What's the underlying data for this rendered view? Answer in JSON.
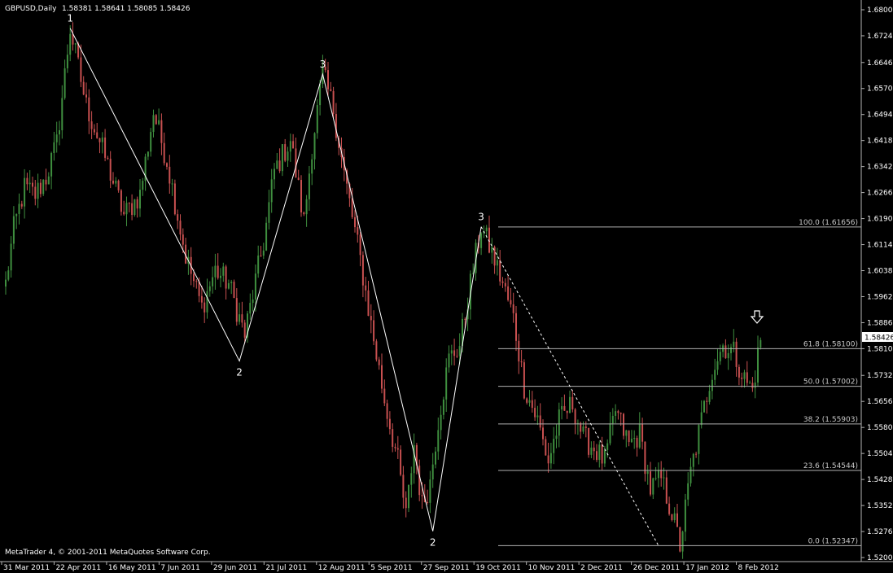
{
  "header": {
    "symbol": "GBPUSD,Daily",
    "ohlc": "1.58381 1.58641 1.58085 1.58426"
  },
  "footer": {
    "copyright": "MetaTrader 4, © 2001-2011 MetaQuotes Software Corp."
  },
  "colors": {
    "background": "#000000",
    "bull": "#3f8f3f",
    "bear": "#c85050",
    "lines": "#ffffff",
    "fib": "#b0b0b0",
    "frame": "#b4b4b4"
  },
  "chart_data": {
    "type": "candlestick",
    "y_ticks": [
      "1.68000",
      "1.67240",
      "1.66460",
      "1.65700",
      "1.64940",
      "1.64180",
      "1.63420",
      "1.62660",
      "1.61900",
      "1.61140",
      "1.60380",
      "1.59620",
      "1.58860",
      "1.58100",
      "1.57320",
      "1.56560",
      "1.55800",
      "1.55040",
      "1.54280",
      "1.53520",
      "1.52760",
      "1.52000"
    ],
    "ylim": [
      1.52,
      1.68
    ],
    "x_ticks": [
      "31 Mar 2011",
      "22 Apr 2011",
      "16 May 2011",
      "7 Jun 2011",
      "29 Jun 2011",
      "21 Jul 2011",
      "12 Aug 2011",
      "5 Sep 2011",
      "27 Sep 2011",
      "19 Oct 2011",
      "10 Nov 2011",
      "2 Dec 2011",
      "26 Dec 2011",
      "17 Jan 2012",
      "8 Feb 2012"
    ],
    "current_price": "1.58426",
    "wave_markers": [
      {
        "label": "1",
        "date": "22 Apr 2011",
        "price": 1.6746
      },
      {
        "label": "2",
        "date": "29 Jun 2011",
        "price": 1.5774
      },
      {
        "label": "3",
        "date": "12 Aug 2011",
        "price": 1.6612
      },
      {
        "label": "2",
        "date": "27 Sep 2011",
        "price": 1.5277
      },
      {
        "label": "3",
        "date": "19 Oct 2011",
        "price": 1.6166
      }
    ],
    "fibonacci": [
      {
        "label": "100.0 (1.61656)",
        "price": 1.61656
      },
      {
        "label": "61.8 (1.58100)",
        "price": 1.581
      },
      {
        "label": "50.0 (1.57002)",
        "price": 1.57002
      },
      {
        "label": "38.2 (1.55903)",
        "price": 1.55903
      },
      {
        "label": "23.6 (1.54544)",
        "price": 1.54544
      },
      {
        "label": "0.0 (1.52347)",
        "price": 1.52347
      }
    ],
    "fib_range": [
      "19 Oct 2011",
      "Jan 2012"
    ],
    "last_arrow": "down",
    "price_path": [
      [
        0,
        1.6
      ],
      [
        3,
        1.616
      ],
      [
        7,
        1.628
      ],
      [
        11,
        1.626
      ],
      [
        15,
        1.631
      ],
      [
        19,
        1.641
      ],
      [
        24,
        1.6746
      ],
      [
        30,
        1.652
      ],
      [
        37,
        1.637
      ],
      [
        44,
        1.62
      ],
      [
        50,
        1.626
      ],
      [
        55,
        1.65
      ],
      [
        60,
        1.636
      ],
      [
        67,
        1.608
      ],
      [
        73,
        1.593
      ],
      [
        78,
        1.604
      ],
      [
        83,
        1.6
      ],
      [
        89,
        1.585
      ],
      [
        92,
        1.597
      ],
      [
        96,
        1.612
      ],
      [
        100,
        1.633
      ],
      [
        106,
        1.642
      ],
      [
        111,
        1.618
      ],
      [
        114,
        1.64
      ],
      [
        118,
        1.6612
      ],
      [
        122,
        1.651
      ],
      [
        126,
        1.632
      ],
      [
        132,
        1.607
      ],
      [
        136,
        1.588
      ],
      [
        141,
        1.566
      ],
      [
        146,
        1.548
      ],
      [
        149,
        1.532
      ],
      [
        152,
        1.553
      ],
      [
        155,
        1.535
      ],
      [
        158,
        1.542
      ],
      [
        161,
        1.56
      ],
      [
        165,
        1.578
      ],
      [
        169,
        1.582
      ],
      [
        173,
        1.6
      ],
      [
        177,
        1.6166
      ],
      [
        181,
        1.609
      ],
      [
        185,
        1.6
      ],
      [
        189,
        1.59
      ],
      [
        193,
        1.57
      ],
      [
        198,
        1.56
      ],
      [
        202,
        1.548
      ],
      [
        206,
        1.56
      ],
      [
        211,
        1.565
      ],
      [
        215,
        1.555
      ],
      [
        219,
        1.552
      ],
      [
        223,
        1.548
      ],
      [
        227,
        1.563
      ],
      [
        232,
        1.553
      ],
      [
        236,
        1.556
      ],
      [
        240,
        1.54
      ],
      [
        244,
        1.543
      ],
      [
        248,
        1.533
      ],
      [
        251,
        1.5235
      ],
      [
        255,
        1.545
      ],
      [
        259,
        1.56
      ],
      [
        263,
        1.575
      ],
      [
        267,
        1.582
      ],
      [
        271,
        1.58
      ],
      [
        275,
        1.572
      ],
      [
        278,
        1.569
      ],
      [
        281,
        1.584
      ]
    ],
    "wave_lines": [
      [
        [
          24,
          1.6746
        ],
        [
          87,
          1.5774
        ],
        [
          118,
          1.6612
        ],
        [
          159,
          1.5277
        ],
        [
          177,
          1.6166
        ]
      ]
    ],
    "dashed_line": [
      [
        177,
        1.6166
      ],
      [
        243,
        1.5235
      ]
    ]
  }
}
